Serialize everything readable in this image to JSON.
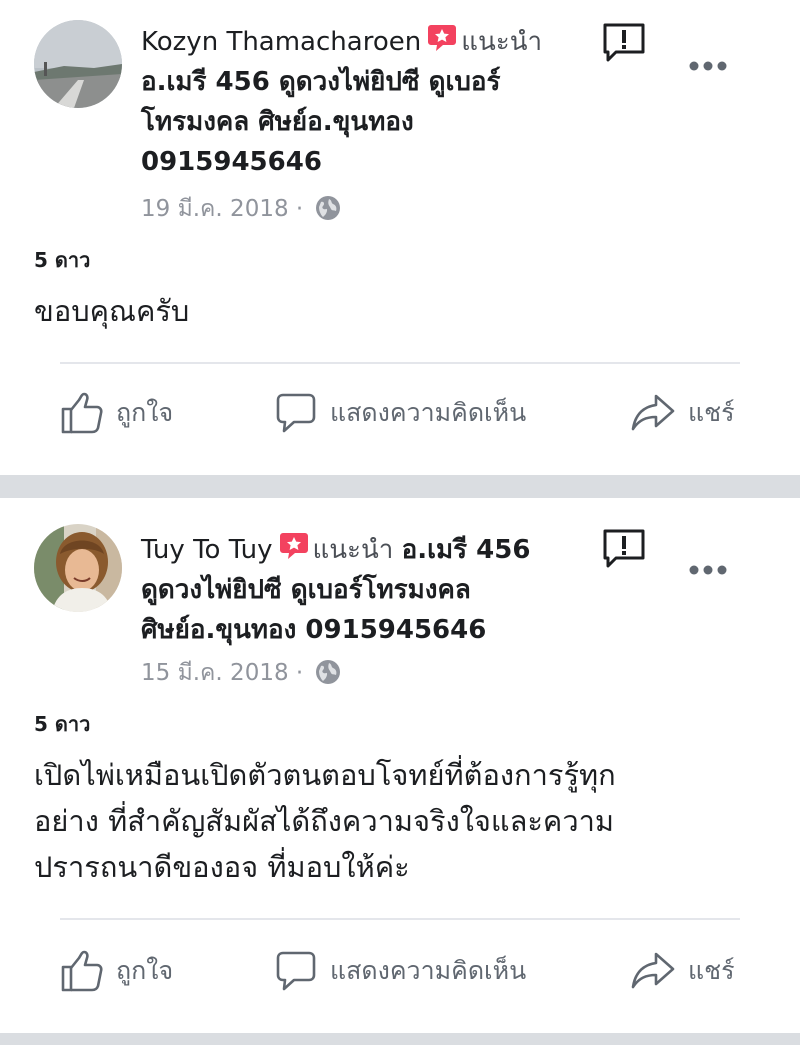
{
  "posts": [
    {
      "author": "Kozyn Thamacharoen",
      "recommends": "แนะนำ",
      "place": "อ.เมรี 456 ดูดวงไพ่ยิปซี ดูเบอร์โทรมงคล ศิษย์อ.ขุนทอง 0915945646",
      "place_lines": [
        "อ.เมรี 456 ดูดวงไพ่ยิปซี ดูเบอร์",
        "โทรมงคล ศิษย์อ.ขุนทอง",
        "0915945646"
      ],
      "date": "19 มี.ค. 2018 ·",
      "rating": "5 ดาว",
      "body": [
        "ขอบคุณครับ"
      ]
    },
    {
      "author": "Tuy To Tuy",
      "recommends": "แนะนำ",
      "place": "อ.เมรี 456 ดูดวงไพ่ยิปซี ดูเบอร์โทรมงคล ศิษย์อ.ขุนทอง 0915945646",
      "place_lines": [
        "อ.เมรี 456",
        "ดูดวงไพ่ยิปซี ดูเบอร์โทรมงคล",
        "ศิษย์อ.ขุนทอง 0915945646"
      ],
      "date": "15 มี.ค. 2018 ·",
      "rating": "5 ดาว",
      "body": [
        "เปิดไพ่เหมือนเปิดตัวตนตอบโจทย์ที่ต้องการรู้ทุก",
        "อย่าง ที่สำคัญสัมผัสได้ถึงความจริงใจและความ",
        "ปรารถนาดีของอจ ที่มอบให้ค่ะ"
      ]
    }
  ],
  "actions": {
    "like": "ถูกใจ",
    "comment": "แสดงความคิดเห็น",
    "share": "แชร์"
  },
  "colors": {
    "recommend_badge": "#f3425f",
    "muted_text": "#90949c",
    "action_text": "#606770",
    "page_background": "#dadde1"
  },
  "icons": [
    "recommend-badge-icon",
    "report-icon",
    "more-options-icon",
    "globe-icon",
    "like-icon",
    "comment-icon",
    "share-icon"
  ]
}
